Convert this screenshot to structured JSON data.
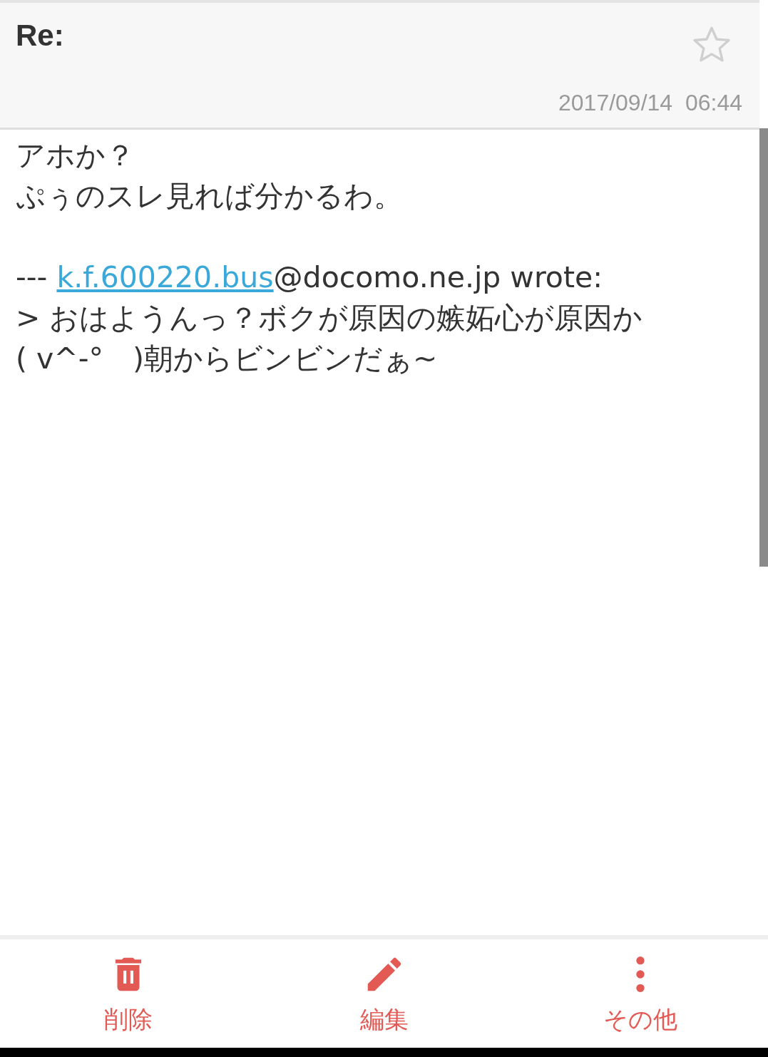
{
  "header": {
    "subject": "Re:",
    "starred": false,
    "date": "2017/09/14  06:44"
  },
  "body": {
    "paragraphs": [
      {
        "lines": [
          {
            "kind": "text",
            "text": "アホか？"
          },
          {
            "kind": "text",
            "text": "ぷぅのスレ見れば分かるわ。"
          }
        ]
      },
      {
        "lines": [
          {
            "kind": "quote_header",
            "prefix": "--- ",
            "link": "k.f.600220.bus",
            "suffix": "@docomo.ne.jp wrote:"
          },
          {
            "kind": "text",
            "text": "> おはようんっ？ボクが原因の嫉妬心が原因か"
          },
          {
            "kind": "text",
            "text": "( v^-°　)朝からビンビンだぁ~"
          }
        ]
      }
    ]
  },
  "actions": [
    {
      "kind": "delete",
      "label": "削除"
    },
    {
      "kind": "edit",
      "label": "編集"
    },
    {
      "kind": "more",
      "label": "その他"
    }
  ]
}
